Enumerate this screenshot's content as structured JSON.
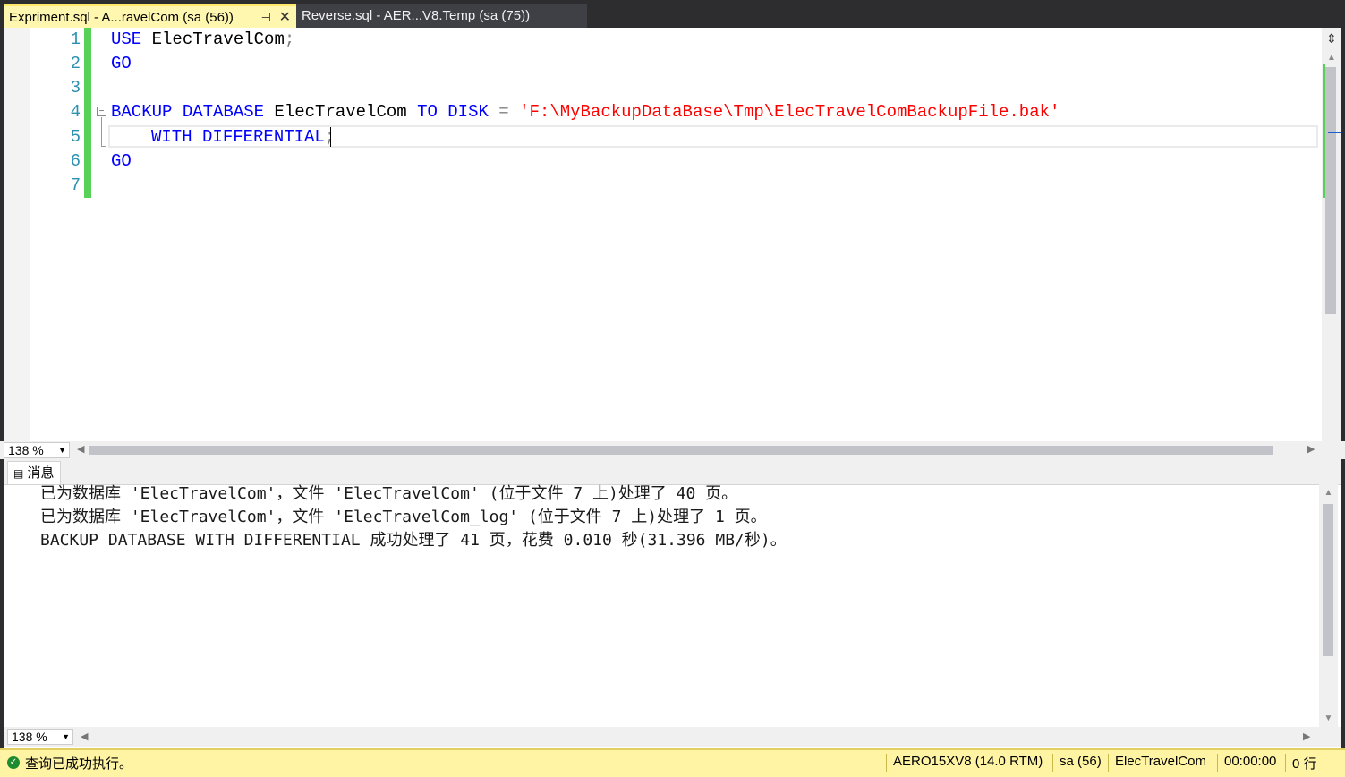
{
  "tabs": [
    {
      "label": "Expriment.sql - A...ravelCom (sa (56))",
      "active": true
    },
    {
      "label": "Reverse.sql - AER...V8.Temp (sa (75))",
      "active": false
    }
  ],
  "editor": {
    "line_numbers": [
      "1",
      "2",
      "3",
      "4",
      "5",
      "6",
      "7"
    ],
    "lines": {
      "l1": {
        "kw": "USE",
        "rest": " ElecTravelCom",
        "semi": ";"
      },
      "l2": {
        "kw": "GO"
      },
      "l4": {
        "kw1": "BACKUP DATABASE",
        "name": " ElecTravelCom ",
        "kw2": "TO DISK",
        "op": " = ",
        "str": "'F:\\MyBackupDataBase\\Tmp\\ElecTravelComBackupFile.bak'"
      },
      "l5": {
        "kw": "WITH DIFFERENTIAL",
        "semi": ";"
      },
      "l6": {
        "kw": "GO"
      }
    },
    "zoom": "138 %"
  },
  "results": {
    "tab_label": "消息",
    "messages": [
      "已为数据库 'ElecTravelCom'，文件 'ElecTravelCom' (位于文件 7 上)处理了 40 页。",
      "已为数据库 'ElecTravelCom'，文件 'ElecTravelCom_log' (位于文件 7 上)处理了 1 页。",
      "BACKUP DATABASE WITH DIFFERENTIAL 成功处理了 41 页，花费 0.010 秒(31.396 MB/秒)。"
    ],
    "zoom": "138 %"
  },
  "status": {
    "message": "查询已成功执行。",
    "server": "AERO15XV8 (14.0 RTM)",
    "user": "sa (56)",
    "database": "ElecTravelCom",
    "elapsed": "00:00:00",
    "rows": "0 行"
  },
  "colors": {
    "keyword": "#0000ff",
    "string": "#ff0000",
    "line_number": "#2b91af",
    "changebar": "#57d157",
    "status_bg": "#fff4a3"
  }
}
